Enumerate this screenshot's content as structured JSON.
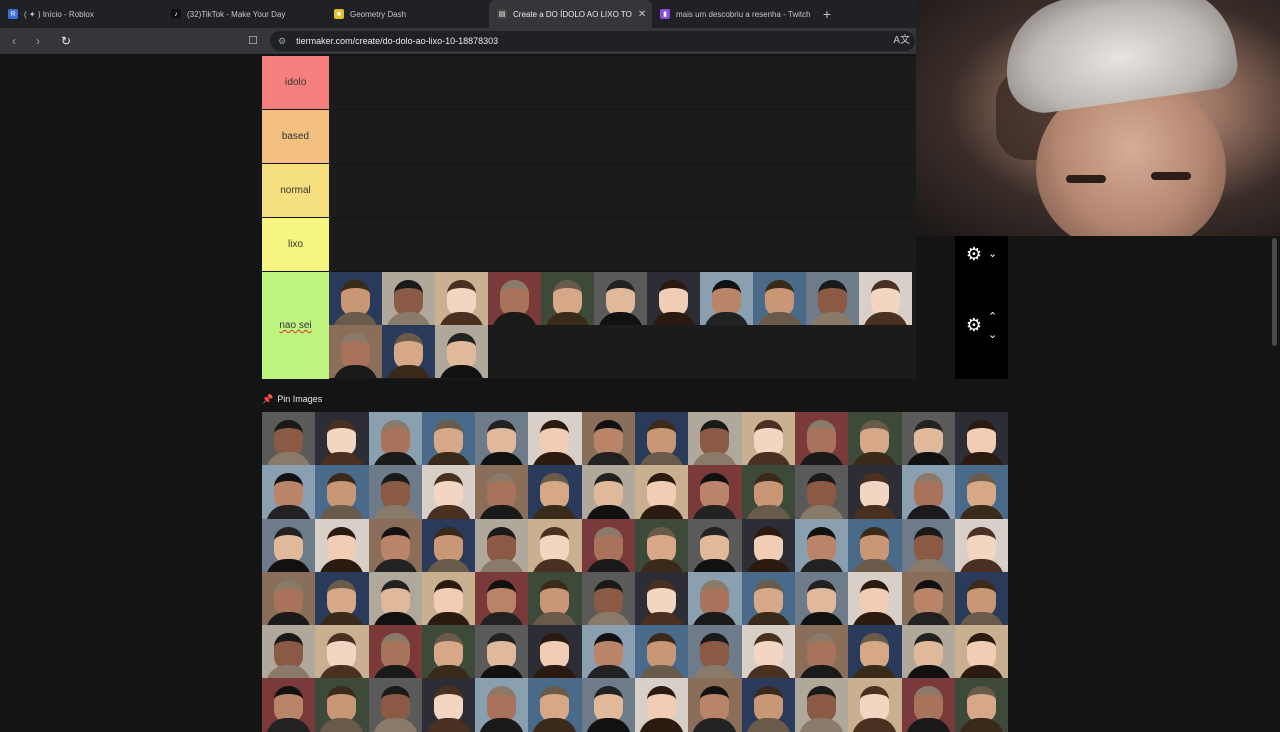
{
  "browser": {
    "tabs": [
      {
        "label": "( ✦ ) Início - Roblox",
        "fav": "#3d6fe0",
        "glyph": "R"
      },
      {
        "label": "(32)TikTok - Make Your Day",
        "fav": "#111111",
        "glyph": "♪"
      },
      {
        "label": "Geometry Dash",
        "fav": "#e0c030",
        "glyph": "■"
      },
      {
        "label": "Create a DO ÍDOLO AO LIXO TO",
        "fav": "#444444",
        "glyph": "▤",
        "active": true
      },
      {
        "label": "mais um descobriu a resenha - Twitch",
        "fav": "#8a4be0",
        "glyph": "▮"
      }
    ],
    "url": "tiermaker.com/create/do-dolo-ao-lixo-10-18878303"
  },
  "tiers": [
    {
      "label": "ídolo",
      "color": "#f57f7f",
      "height": 54
    },
    {
      "label": "based",
      "color": "#f5bf7f",
      "height": 54
    },
    {
      "label": "normal",
      "color": "#f5df7f",
      "height": 54
    },
    {
      "label": "lixo",
      "color": "#f5f57f",
      "height": 54
    },
    {
      "label": "nao sei",
      "color": "#bff57f",
      "height": 108
    }
  ],
  "pin_images_label": "Pin Images",
  "icons": {
    "gear": "gear-icon",
    "up": "chevron-up-icon",
    "down": "chevron-down-icon",
    "pin": "pin-icon"
  }
}
